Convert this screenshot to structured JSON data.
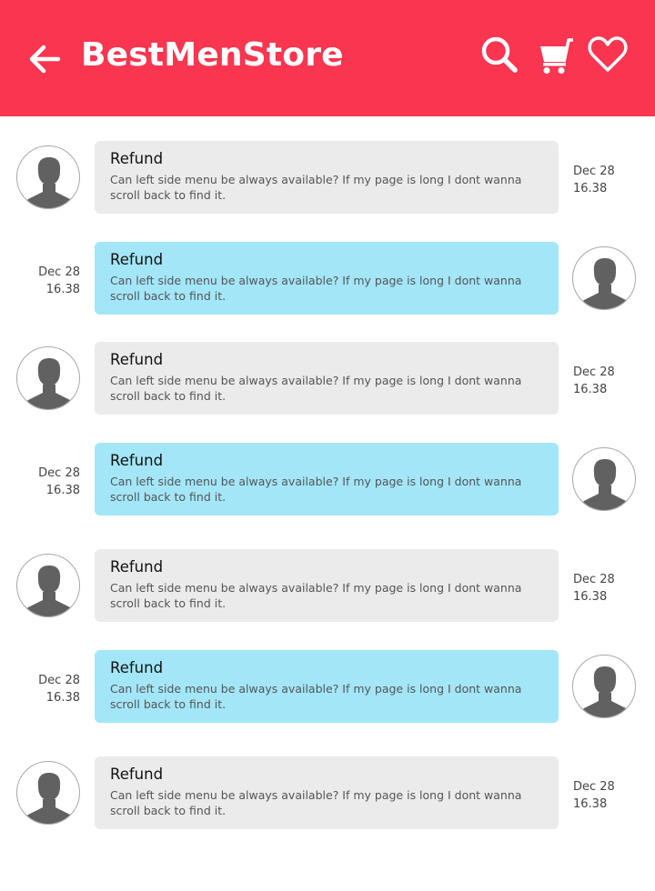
{
  "header": {
    "title": "BestMenStore",
    "back_icon": "arrow-left-icon",
    "actions": [
      "search-icon",
      "cart-icon",
      "heart-icon"
    ],
    "color": "#f93550"
  },
  "colors": {
    "incoming_bubble": "#ebebeb",
    "outgoing_bubble": "#a3e6f8"
  },
  "messages": [
    {
      "direction": "incoming",
      "subject": "Refund",
      "body": "Can left side menu be always available? If my page is long I dont wanna scroll back to find it.",
      "date": "Dec 28",
      "time": "16.38"
    },
    {
      "direction": "outgoing",
      "subject": "Refund",
      "body": "Can left side menu be always available? If my page is long I dont wanna scroll back to find it.",
      "date": "Dec 28",
      "time": "16.38"
    },
    {
      "direction": "incoming",
      "subject": "Refund",
      "body": "Can left side menu be always available? If my page is long I dont wanna scroll back to find it.",
      "date": "Dec 28",
      "time": "16.38"
    },
    {
      "direction": "outgoing",
      "subject": "Refund",
      "body": "Can left side menu be always available? If my page is long I dont wanna scroll back to find it.",
      "date": "Dec 28",
      "time": "16.38"
    },
    {
      "direction": "incoming",
      "subject": "Refund",
      "body": "Can left side menu be always available? If my page is long I dont wanna scroll back to find it.",
      "date": "Dec 28",
      "time": "16.38"
    },
    {
      "direction": "outgoing",
      "subject": "Refund",
      "body": "Can left side menu be always available? If my page is long I dont wanna scroll back to find it.",
      "date": "Dec 28",
      "time": "16.38"
    },
    {
      "direction": "incoming",
      "subject": "Refund",
      "body": "Can left side menu be always available? If my page is long I dont wanna scroll back to find it.",
      "date": "Dec 28",
      "time": "16.38"
    }
  ]
}
